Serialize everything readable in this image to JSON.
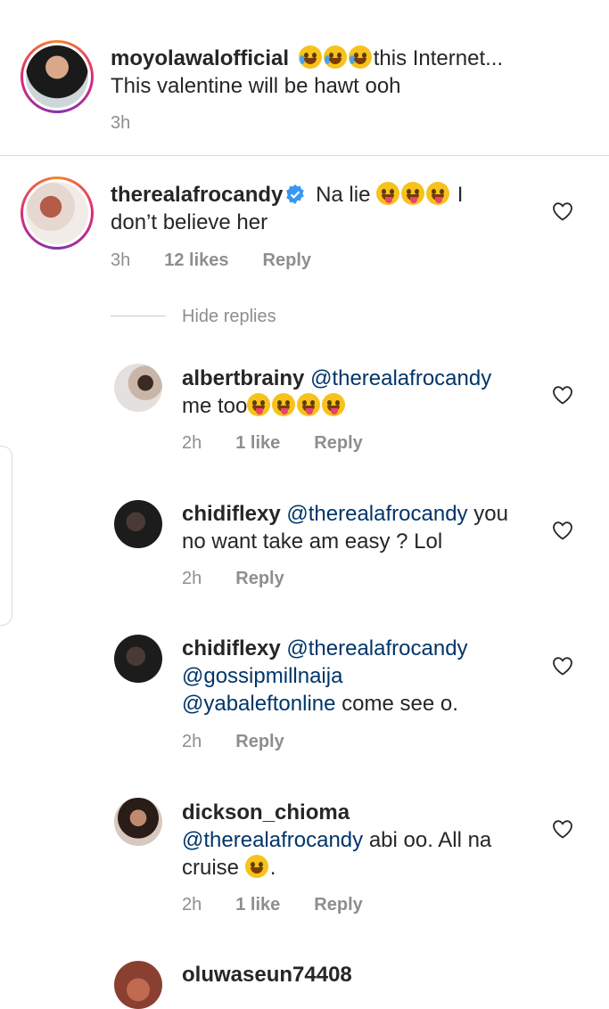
{
  "caption": {
    "username": "moyolawalofficial",
    "text_after_emoji": "this Internet...",
    "line2": "This valentine will be hawt ooh",
    "time": "3h"
  },
  "top_comment": {
    "username": "therealafrocandy",
    "text": "Na lie",
    "text_end": " I",
    "line2": "don’t believe her",
    "time": "3h",
    "likes": "12 likes",
    "reply": "Reply"
  },
  "hide_replies": "Hide replies",
  "replies": [
    {
      "username": "albertbrainy",
      "mention": "@therealafrocandy",
      "line2": "me too",
      "time": "2h",
      "likes": "1 like",
      "reply": "Reply"
    },
    {
      "username": "chidiflexy",
      "mention": "@therealafrocandy",
      "text_end": " you",
      "line2": "no want take am easy ? Lol",
      "time": "2h",
      "reply": "Reply"
    },
    {
      "username": "chidiflexy",
      "mention": "@therealafrocandy",
      "mention2": "@gossipmillnaija",
      "mention3": "@yabaleftonline",
      "text_end": " come see o.",
      "time": "2h",
      "reply": "Reply"
    },
    {
      "username": "dickson_chioma",
      "mention": "@therealafrocandy",
      "text_end": " abi oo. All na",
      "line3": "cruise ",
      "line3_end": ".",
      "time": "2h",
      "likes": "1 like",
      "reply": "Reply"
    },
    {
      "username": "oluwaseun74408"
    }
  ],
  "icons": {
    "heart": "heart-outline-icon",
    "verified": "verified-badge-icon",
    "emoji_cry": "tears-of-joy-emoji",
    "emoji_zany": "zany-face-emoji",
    "emoji_yum": "yum-face-emoji",
    "emoji_grin": "grinning-face-emoji"
  },
  "colors": {
    "mention": "#003569",
    "meta": "#8e8e8e",
    "verified": "#3897f0"
  }
}
